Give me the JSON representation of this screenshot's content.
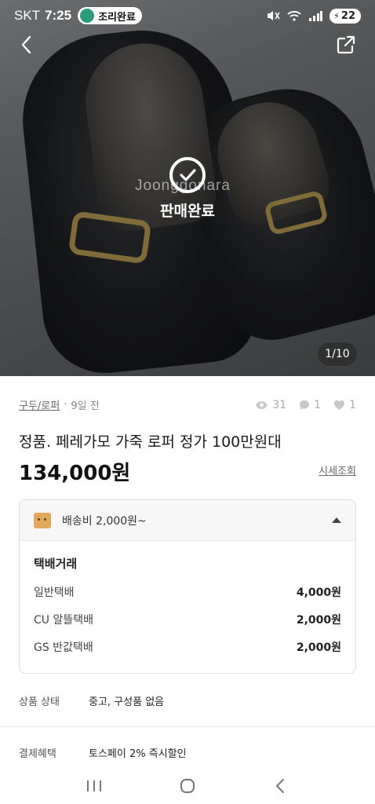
{
  "status_bar": {
    "carrier": "SKT",
    "time": "7:25",
    "notification_label": "조리완료",
    "battery": "22"
  },
  "hero": {
    "sold_label": "판매완료",
    "watermark": "Joonggonara",
    "page_counter": "1/10"
  },
  "product": {
    "category": "구두/로퍼",
    "posted": "9일 전",
    "views": "31",
    "chats": "1",
    "likes": "1",
    "title": "정품. 페레가모 가죽 로퍼 정가 100만원대",
    "price": "134,000원",
    "market_link": "시세조회"
  },
  "shipping": {
    "summary": "배송비 2,000원~",
    "section_title": "택배거래",
    "options": [
      {
        "name": "일반택배",
        "price": "4,000원"
      },
      {
        "name": "CU 알뜰택배",
        "price": "2,000원"
      },
      {
        "name": "GS 반값택배",
        "price": "2,000원"
      }
    ]
  },
  "details": {
    "condition_label": "상품 상태",
    "condition_value": "중고, 구성품 없음",
    "payment_label": "결제혜택",
    "payment_value": "토스페이 2% 즉시할인"
  },
  "icons": {
    "back": "back-arrow-icon",
    "share": "share-icon",
    "views": "eye-icon",
    "chats": "chat-icon",
    "likes": "heart-icon",
    "sold": "check-circle-icon"
  }
}
